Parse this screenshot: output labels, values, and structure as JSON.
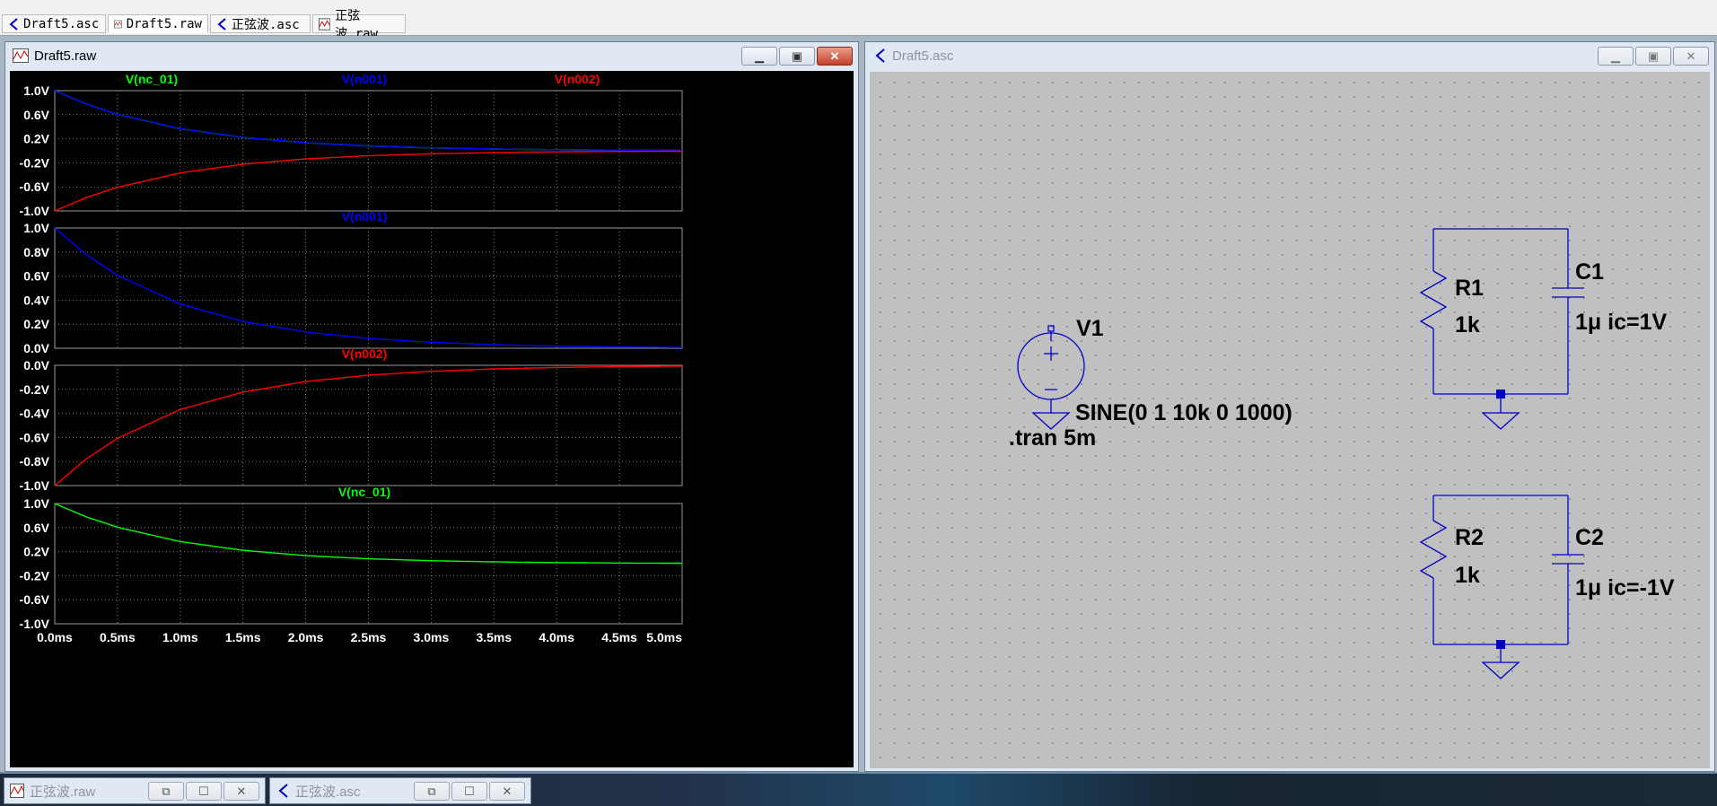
{
  "tabs": [
    {
      "label": "Draft5.asc",
      "icon": "schematic-icon",
      "active": false
    },
    {
      "label": "Draft5.raw",
      "icon": "waveform-icon",
      "active": true
    },
    {
      "label": "正弦波.asc",
      "icon": "schematic-icon",
      "active": false
    },
    {
      "label": "正弦波.raw",
      "icon": "waveform-icon",
      "active": false
    }
  ],
  "waveform_window": {
    "title": "Draft5.raw",
    "buttons": {
      "minimize": "minimize",
      "restore": "restore",
      "close": "close"
    }
  },
  "schematic_window": {
    "title": "Draft5.asc",
    "components": {
      "v1": {
        "name": "V1",
        "value": "SINE(0 1 10k 0 1000)"
      },
      "tran": ".tran 5m",
      "r1": {
        "name": "R1",
        "value": "1k"
      },
      "c1": {
        "name": "C1",
        "value": "1μ ic=1V"
      },
      "r2": {
        "name": "R2",
        "value": "1k"
      },
      "c2": {
        "name": "C2",
        "value": "1μ ic=-1V"
      }
    }
  },
  "minimized_windows": [
    {
      "title": "正弦波.raw"
    },
    {
      "title": "正弦波.asc"
    }
  ],
  "colors": {
    "nc01": "#00ff00",
    "n001": "#0000ff",
    "n002": "#ff0000",
    "plot_bg": "#000000",
    "grid": "#7f7f7f",
    "schematic_wire": "#0000c8",
    "schematic_bg": "#c0c0c0"
  },
  "chart_data": [
    {
      "type": "line",
      "title": "",
      "xlabel": "",
      "ylabel": "",
      "xlim": [
        0,
        5
      ],
      "x_ticks": [
        "0.0ms",
        "0.5ms",
        "1.0ms",
        "1.5ms",
        "2.0ms",
        "2.5ms",
        "3.0ms",
        "3.5ms",
        "4.0ms",
        "4.5ms",
        "5.0ms"
      ],
      "ylim": [
        -1.0,
        1.0
      ],
      "y_ticks": [
        "1.0V",
        "0.6V",
        "0.2V",
        "-0.2V",
        "-0.6V",
        "-1.0V"
      ],
      "grid": true,
      "series": [
        {
          "name": "V(nc_01)",
          "color": "#00ff00",
          "x": [
            0,
            0.25,
            0.5,
            1.0,
            1.5,
            2.0,
            2.5,
            3.0,
            3.5,
            4.0,
            4.5,
            5.0
          ],
          "envelope": [
            1.0,
            0.779,
            0.607,
            0.368,
            0.223,
            0.135,
            0.082,
            0.05,
            0.03,
            0.018,
            0.011,
            0.007
          ],
          "oscillation_frequency_khz": 10
        },
        {
          "name": "V(n001)",
          "color": "#0000ff",
          "x": [
            0,
            0.25,
            0.5,
            1.0,
            1.5,
            2.0,
            2.5,
            3.0,
            3.5,
            4.0,
            4.5,
            5.0
          ],
          "y": [
            1.0,
            0.779,
            0.607,
            0.368,
            0.223,
            0.135,
            0.082,
            0.05,
            0.03,
            0.018,
            0.011,
            0.007
          ]
        },
        {
          "name": "V(n002)",
          "color": "#ff0000",
          "x": [
            0,
            0.25,
            0.5,
            1.0,
            1.5,
            2.0,
            2.5,
            3.0,
            3.5,
            4.0,
            4.5,
            5.0
          ],
          "y": [
            -1.0,
            -0.779,
            -0.607,
            -0.368,
            -0.223,
            -0.135,
            -0.082,
            -0.05,
            -0.03,
            -0.018,
            -0.011,
            -0.007
          ]
        }
      ]
    },
    {
      "type": "line",
      "title": "",
      "xlim": [
        0,
        5
      ],
      "ylim": [
        0.0,
        1.0
      ],
      "y_ticks": [
        "1.0V",
        "0.8V",
        "0.6V",
        "0.4V",
        "0.2V",
        "0.0V"
      ],
      "grid": true,
      "series": [
        {
          "name": "V(n001)",
          "color": "#0000ff",
          "x": [
            0,
            0.25,
            0.5,
            1.0,
            1.5,
            2.0,
            2.5,
            3.0,
            3.5,
            4.0,
            4.5,
            5.0
          ],
          "y": [
            1.0,
            0.779,
            0.607,
            0.368,
            0.223,
            0.135,
            0.082,
            0.05,
            0.03,
            0.018,
            0.011,
            0.007
          ]
        }
      ]
    },
    {
      "type": "line",
      "title": "",
      "xlim": [
        0,
        5
      ],
      "ylim": [
        -1.0,
        0.0
      ],
      "y_ticks": [
        "0.0V",
        "-0.2V",
        "-0.4V",
        "-0.6V",
        "-0.8V",
        "-1.0V"
      ],
      "grid": true,
      "series": [
        {
          "name": "V(n002)",
          "color": "#ff0000",
          "x": [
            0,
            0.25,
            0.5,
            1.0,
            1.5,
            2.0,
            2.5,
            3.0,
            3.5,
            4.0,
            4.5,
            5.0
          ],
          "y": [
            -1.0,
            -0.779,
            -0.607,
            -0.368,
            -0.223,
            -0.135,
            -0.082,
            -0.05,
            -0.03,
            -0.018,
            -0.011,
            -0.007
          ]
        }
      ]
    },
    {
      "type": "line",
      "title": "",
      "xlim": [
        0,
        5
      ],
      "ylim": [
        -1.0,
        1.0
      ],
      "y_ticks": [
        "1.0V",
        "0.6V",
        "0.2V",
        "-0.2V",
        "-0.6V",
        "-1.0V"
      ],
      "x_ticks": [
        "0.0ms",
        "0.5ms",
        "1.0ms",
        "1.5ms",
        "2.0ms",
        "2.5ms",
        "3.0ms",
        "3.5ms",
        "4.0ms",
        "4.5ms",
        "5.0ms"
      ],
      "grid": true,
      "series": [
        {
          "name": "V(nc_01)",
          "color": "#00ff00",
          "x": [
            0,
            0.25,
            0.5,
            1.0,
            1.5,
            2.0,
            2.5,
            3.0,
            3.5,
            4.0,
            4.5,
            5.0
          ],
          "envelope": [
            1.0,
            0.779,
            0.607,
            0.368,
            0.223,
            0.135,
            0.082,
            0.05,
            0.03,
            0.018,
            0.011,
            0.007
          ],
          "oscillation_frequency_khz": 10
        }
      ]
    }
  ]
}
